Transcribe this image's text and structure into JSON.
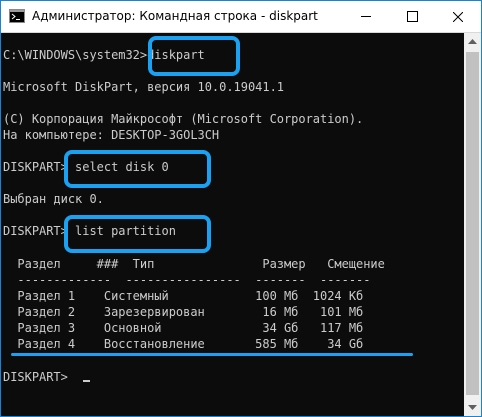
{
  "window": {
    "title": "Администратор: Командная строка - diskpart",
    "icon": "cmd-icon",
    "controls": [
      "minimize-icon",
      "maximize-icon",
      "close-icon"
    ]
  },
  "console": {
    "lines": [
      "C:\\WINDOWS\\system32>diskpart",
      "",
      "Microsoft DiskPart, версия 10.0.19041.1",
      "",
      "(C) Корпорация Майкрософт (Microsoft Corporation).",
      "На компьютере: DESKTOP-3GOL3CH",
      "",
      "DISKPART> select disk 0",
      "",
      "Выбран диск 0.",
      "",
      "DISKPART> list partition",
      "",
      "  Раздел     ###  Тип               Размер   Смещение",
      "  -------------  ----------------  -------  -------",
      "  Раздел 1    Системный            100 Мб  1024 Кб",
      "  Раздел 2    Зарезервирован        16 Мб   101 Мб",
      "  Раздел 3    Основной              34 Gб   117 Мб",
      "  Раздел 4    Восстановление       585 Мб    34 Gб",
      "",
      "",
      "DISKPART> "
    ]
  },
  "annotations": {
    "highlight_color": "#1ba1f2"
  }
}
